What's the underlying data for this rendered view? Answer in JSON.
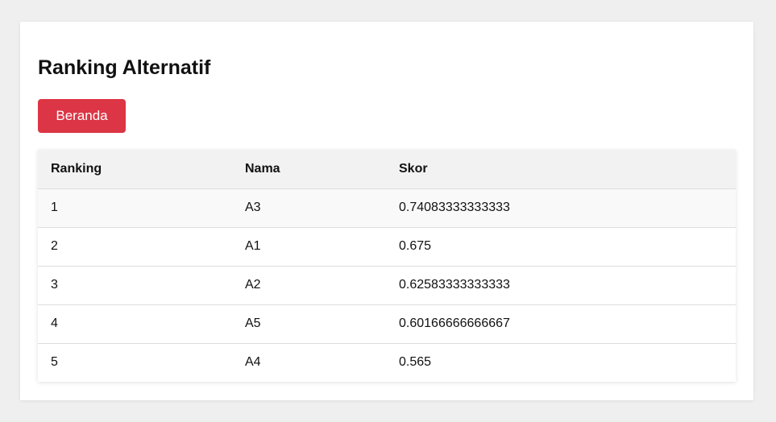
{
  "page": {
    "title": "Ranking Alternatif",
    "home_button_label": "Beranda"
  },
  "table": {
    "headers": [
      "Ranking",
      "Nama",
      "Skor"
    ],
    "rows": [
      {
        "ranking": "1",
        "nama": "A3",
        "skor": "0.74083333333333"
      },
      {
        "ranking": "2",
        "nama": "A1",
        "skor": "0.675"
      },
      {
        "ranking": "3",
        "nama": "A2",
        "skor": "0.62583333333333"
      },
      {
        "ranking": "4",
        "nama": "A5",
        "skor": "0.60166666666667"
      },
      {
        "ranking": "5",
        "nama": "A4",
        "skor": "0.565"
      }
    ]
  },
  "colors": {
    "accent_button": "#dc3545",
    "page_background": "#efefef",
    "header_background": "#f2f2f2"
  }
}
